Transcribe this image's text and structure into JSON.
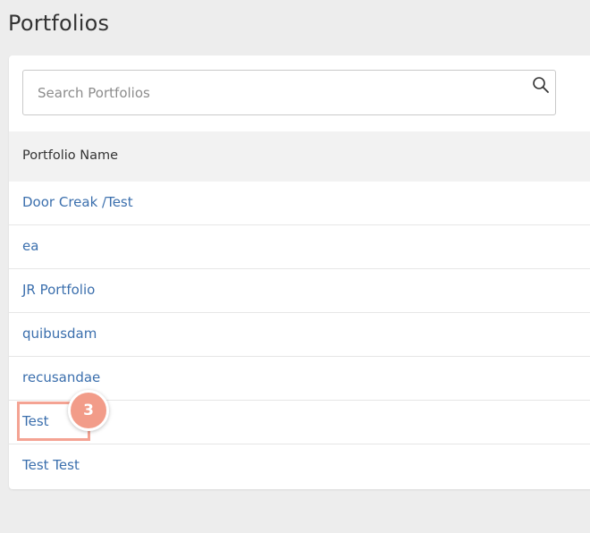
{
  "page": {
    "title": "Portfolios"
  },
  "search": {
    "placeholder": "Search Portfolios",
    "value": ""
  },
  "table": {
    "columns": [
      "Portfolio Name"
    ],
    "rows": [
      {
        "name": "Door Creak /Test"
      },
      {
        "name": "ea"
      },
      {
        "name": "JR Portfolio"
      },
      {
        "name": "quibusdam"
      },
      {
        "name": "recusandae"
      },
      {
        "name": "Test"
      },
      {
        "name": "Test Test"
      }
    ]
  },
  "annotation": {
    "step_number": "3",
    "color": "#f29c89"
  },
  "colors": {
    "link": "#3b6fad",
    "background": "#ededed",
    "header_row": "#f2f2f2"
  },
  "icons": {
    "search": "search-icon"
  }
}
